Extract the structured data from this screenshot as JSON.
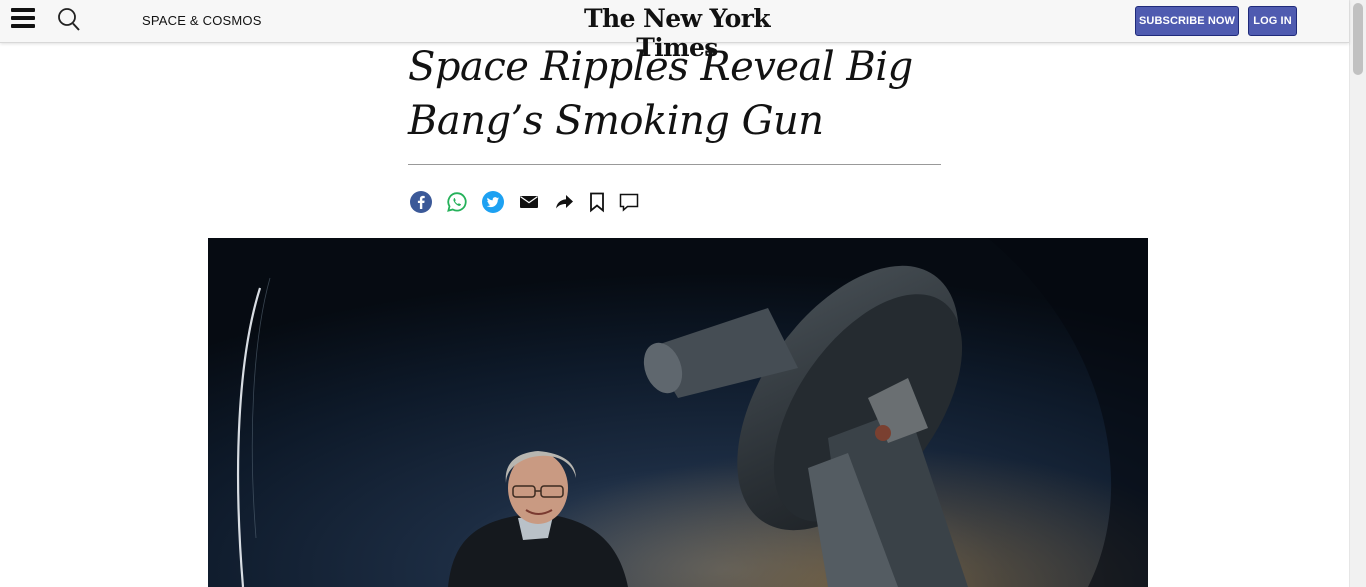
{
  "header": {
    "section_label": "SPACE & COSMOS",
    "logo_text": "The New York Times",
    "subscribe_label": "SUBSCRIBE NOW",
    "login_label": "LOG IN",
    "menu_icon": "hamburger-menu-icon",
    "search_icon": "search-icon"
  },
  "article": {
    "headline": "Space Ripples Reveal Big Bang’s Smoking Gun"
  },
  "share_tools": [
    {
      "icon": "facebook-icon"
    },
    {
      "icon": "whatsapp-icon"
    },
    {
      "icon": "twitter-icon"
    },
    {
      "icon": "email-icon"
    },
    {
      "icon": "share-icon"
    },
    {
      "icon": "bookmark-icon"
    },
    {
      "icon": "comment-icon"
    }
  ],
  "colors": {
    "button_bg": "#4f5bb0",
    "facebook": "#3b5998",
    "whatsapp": "#25d366",
    "twitter": "#1da1f2"
  }
}
